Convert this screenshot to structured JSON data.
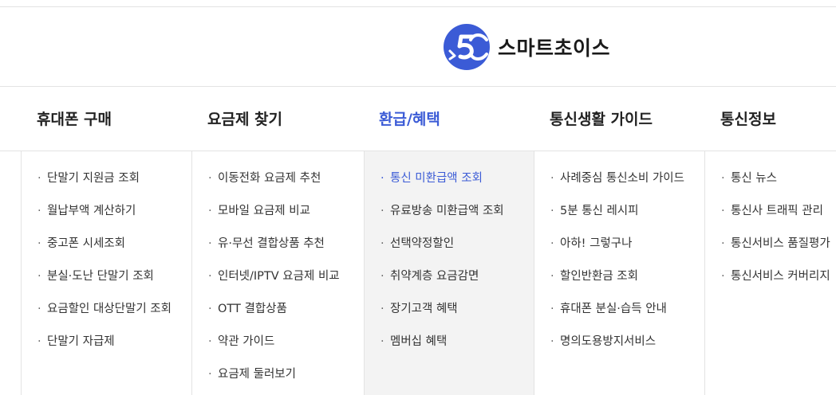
{
  "logo": {
    "text": "스마트초이스",
    "brand_color": "#3b5bd6"
  },
  "nav": {
    "active_color": "#3b5bd6",
    "items": [
      {
        "label": "휴대폰 구매"
      },
      {
        "label": "요금제 찾기"
      },
      {
        "label": "환급/혜택",
        "active": true
      },
      {
        "label": "통신생활 가이드"
      },
      {
        "label": "통신정보"
      }
    ]
  },
  "submenu": {
    "bullet": "·",
    "columns": [
      {
        "items": [
          "단말기 지원금 조회",
          "월납부액 계산하기",
          "중고폰 시세조회",
          "분실·도난 단말기 조회",
          "요금할인 대상단말기 조회",
          "단말기 자급제"
        ]
      },
      {
        "items": [
          "이동전화 요금제 추천",
          "모바일 요금제 비교",
          "유·무선 결합상품 추천",
          "인터넷/IPTV 요금제 비교",
          "OTT 결합상품",
          "약관 가이드",
          "요금제 둘러보기"
        ]
      },
      {
        "items": [
          "통신 미환급액 조회",
          "유료방송 미환급액 조회",
          "선택약정할인",
          "취약계층 요금감면",
          "장기고객 혜택",
          "멤버십 혜택"
        ],
        "selected_index": 0
      },
      {
        "items": [
          "사례중심 통신소비 가이드",
          "5분 통신 레시피",
          "아하! 그렇구나",
          "할인반환금 조회",
          "휴대폰 분실·습득 안내",
          "명의도용방지서비스"
        ]
      },
      {
        "items": [
          "통신 뉴스",
          "통신사 트래픽 관리",
          "통신서비스 품질평가",
          "통신서비스 커버리지"
        ]
      }
    ]
  }
}
